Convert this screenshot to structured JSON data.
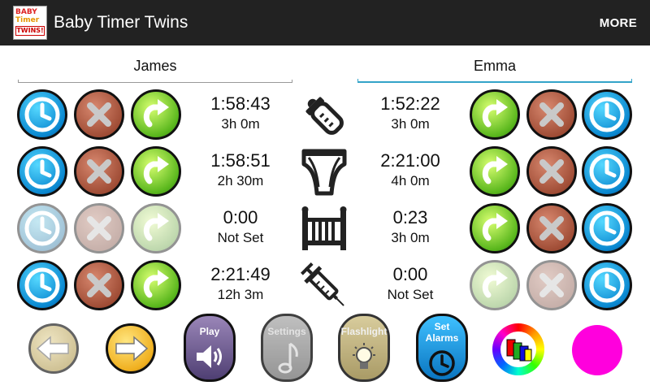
{
  "app": {
    "title": "Baby Timer Twins",
    "icon_lines": [
      "BABY",
      "Timer",
      "TWINS!"
    ],
    "more_label": "MORE"
  },
  "tabs": [
    {
      "name": "James",
      "selected": false
    },
    {
      "name": "Emma",
      "selected": true
    }
  ],
  "categories": [
    "bottle-icon",
    "diaper-icon",
    "crib-icon",
    "medicine-syringe-icon"
  ],
  "rows": [
    {
      "icon": "bottle-icon",
      "left": {
        "time": "1:58:43",
        "interval": "3h 0m",
        "enabled": true
      },
      "right": {
        "time": "1:52:22",
        "interval": "3h 0m",
        "enabled": true
      }
    },
    {
      "icon": "diaper-icon",
      "left": {
        "time": "1:58:51",
        "interval": "2h 30m",
        "enabled": true
      },
      "right": {
        "time": "2:21:00",
        "interval": "4h 0m",
        "enabled": true
      }
    },
    {
      "icon": "crib-icon",
      "left": {
        "time": "0:00",
        "interval": "Not Set",
        "enabled": false
      },
      "right": {
        "time": "0:23",
        "interval": "3h 0m",
        "enabled": true
      }
    },
    {
      "icon": "medicine-syringe-icon",
      "left": {
        "time": "2:21:49",
        "interval": "12h 3m",
        "enabled": true
      },
      "right": {
        "time": "0:00",
        "interval": "Not Set",
        "enabled": false
      }
    }
  ],
  "toolbar": {
    "play_label": "Play",
    "settings_label": "Settings",
    "flashlight_label": "Flashlight",
    "alarms_label_line1": "Set",
    "alarms_label_line2": "Alarms",
    "selected_color": "#ff00dd"
  },
  "colors": {
    "actionbar": "#222222",
    "tab_accent": "#33a3c8",
    "clock_button": "#0a88d0",
    "cancel_button": "#9d4a33",
    "restart_button": "#5ab71d"
  }
}
